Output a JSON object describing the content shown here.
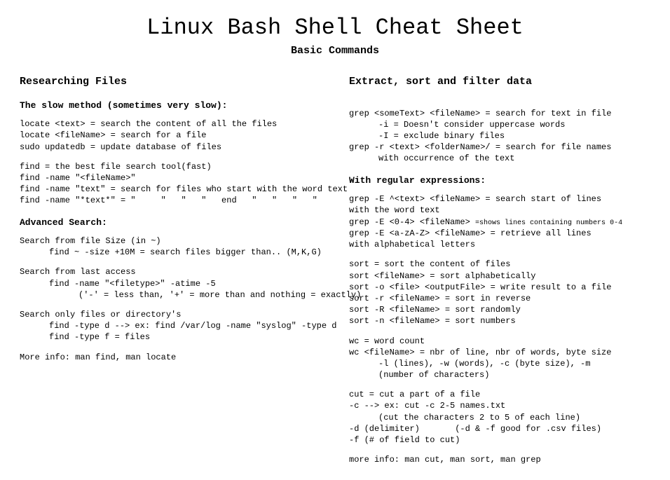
{
  "title": "Linux Bash Shell Cheat Sheet",
  "subtitle": "Basic Commands",
  "left": {
    "heading": "Researching Files",
    "sub1": "The slow method (sometimes very slow):",
    "l1": "locate <text> = search the content of all the files",
    "l2": "locate <fileName> = search for a file",
    "l3": "sudo updatedb = update database of files",
    "l4": "find = the best file search tool(fast)",
    "l5": "find -name \"<fileName>\"",
    "l6": "find -name \"text\" = search for files who start with the word text",
    "l7": "find -name \"*text*\" = \"     \"   \"   \"   end   \"   \"   \"   \"",
    "sub2": "Advanced Search:",
    "l8": "Search from file Size (in ~)",
    "l9": "find ~ -size +10M = search files bigger than.. (M,K,G)",
    "l10": "Search from last access",
    "l11": "find -name \"<filetype>\" -atime -5",
    "l12": "('-' = less than, '+' = more than and nothing = exactly)",
    "l13": "Search only files or directory's",
    "l14": "find -type d --> ex: find /var/log -name \"syslog\" -type d",
    "l15": "find -type f = files",
    "l16": "More info: man find, man locate"
  },
  "right": {
    "heading": "Extract, sort and filter data",
    "r1": "grep <someText> <fileName> = search for text in file",
    "r2": "-i = Doesn't consider uppercase words",
    "r3": "-I = exclude binary files",
    "r4": "grep -r <text> <folderName>/ = search for file names",
    "r5": "with occurrence of the text",
    "sub1": "With regular expressions:",
    "r6": "grep -E ^<text> <fileName> = search start of lines",
    "r7": "with the word text",
    "r8a": "grep -E <0-4> <fileName> ",
    "r8b": "=shows lines containing numbers 0-4",
    "r9": "grep -E <a-zA-Z> <fileName> = retrieve all lines",
    "r10": "with alphabetical letters",
    "r11": "sort = sort the content of files",
    "r12": "sort <fileName> = sort alphabetically",
    "r13": "sort -o <file> <outputFile> = write result to a file",
    "r14": "sort -r <fileName> = sort in reverse",
    "r15": "sort -R <fileName> = sort randomly",
    "r16": "sort -n <fileName> = sort numbers",
    "r17": "wc = word count",
    "r18": "wc <fileName> = nbr of line, nbr of words, byte size",
    "r19": "-l (lines), -w (words), -c (byte size), -m",
    "r20": "(number of characters)",
    "r21": "cut = cut a part of a file",
    "r22": "-c --> ex: cut -c 2-5 names.txt",
    "r23": "(cut the characters 2 to 5 of each line)",
    "r24": "-d (delimiter)       (-d & -f good for .csv files)",
    "r25": "-f (# of field to cut)",
    "r26": "more info: man cut, man sort, man grep"
  }
}
